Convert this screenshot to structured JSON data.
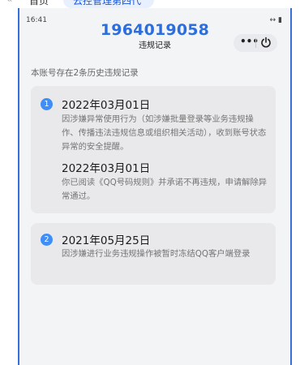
{
  "tabbar": {
    "back_icon": "double-chevron-left-icon",
    "home": "首页",
    "active_tab": "云控管理第四代"
  },
  "status_bar": {
    "time": "16:41",
    "icons": "↔ ▮"
  },
  "header": {
    "number": "1964019058",
    "title": "违规记录"
  },
  "capsule": {
    "more": "•••",
    "close_icon": "power-icon"
  },
  "summary": "本账号存在2条历史违规记录",
  "records": [
    {
      "index": "1",
      "entries": [
        {
          "date": "2022年03月01日",
          "text": "因涉嫌异常使用行为（如涉嫌批量登录等业务违规操作、传播违法违规信息或组织相关活动），收到账号状态异常的安全提醒。"
        },
        {
          "date": "2022年03月01日",
          "text": "你已阅读《QQ号码规则》并承诺不再违规，申请解除异常通过。"
        }
      ]
    },
    {
      "index": "2",
      "entries": [
        {
          "date": "2021年05月25日",
          "text": "因涉嫌进行业务违规操作被暂时冻结QQ客户端登录"
        }
      ]
    }
  ],
  "colors": {
    "accent": "#2a6ee0",
    "badge": "#3f8ef7",
    "frame_border": "#3a6fd8",
    "card_bg": "#e9e9ec",
    "page_bg": "#f3f4f6"
  }
}
